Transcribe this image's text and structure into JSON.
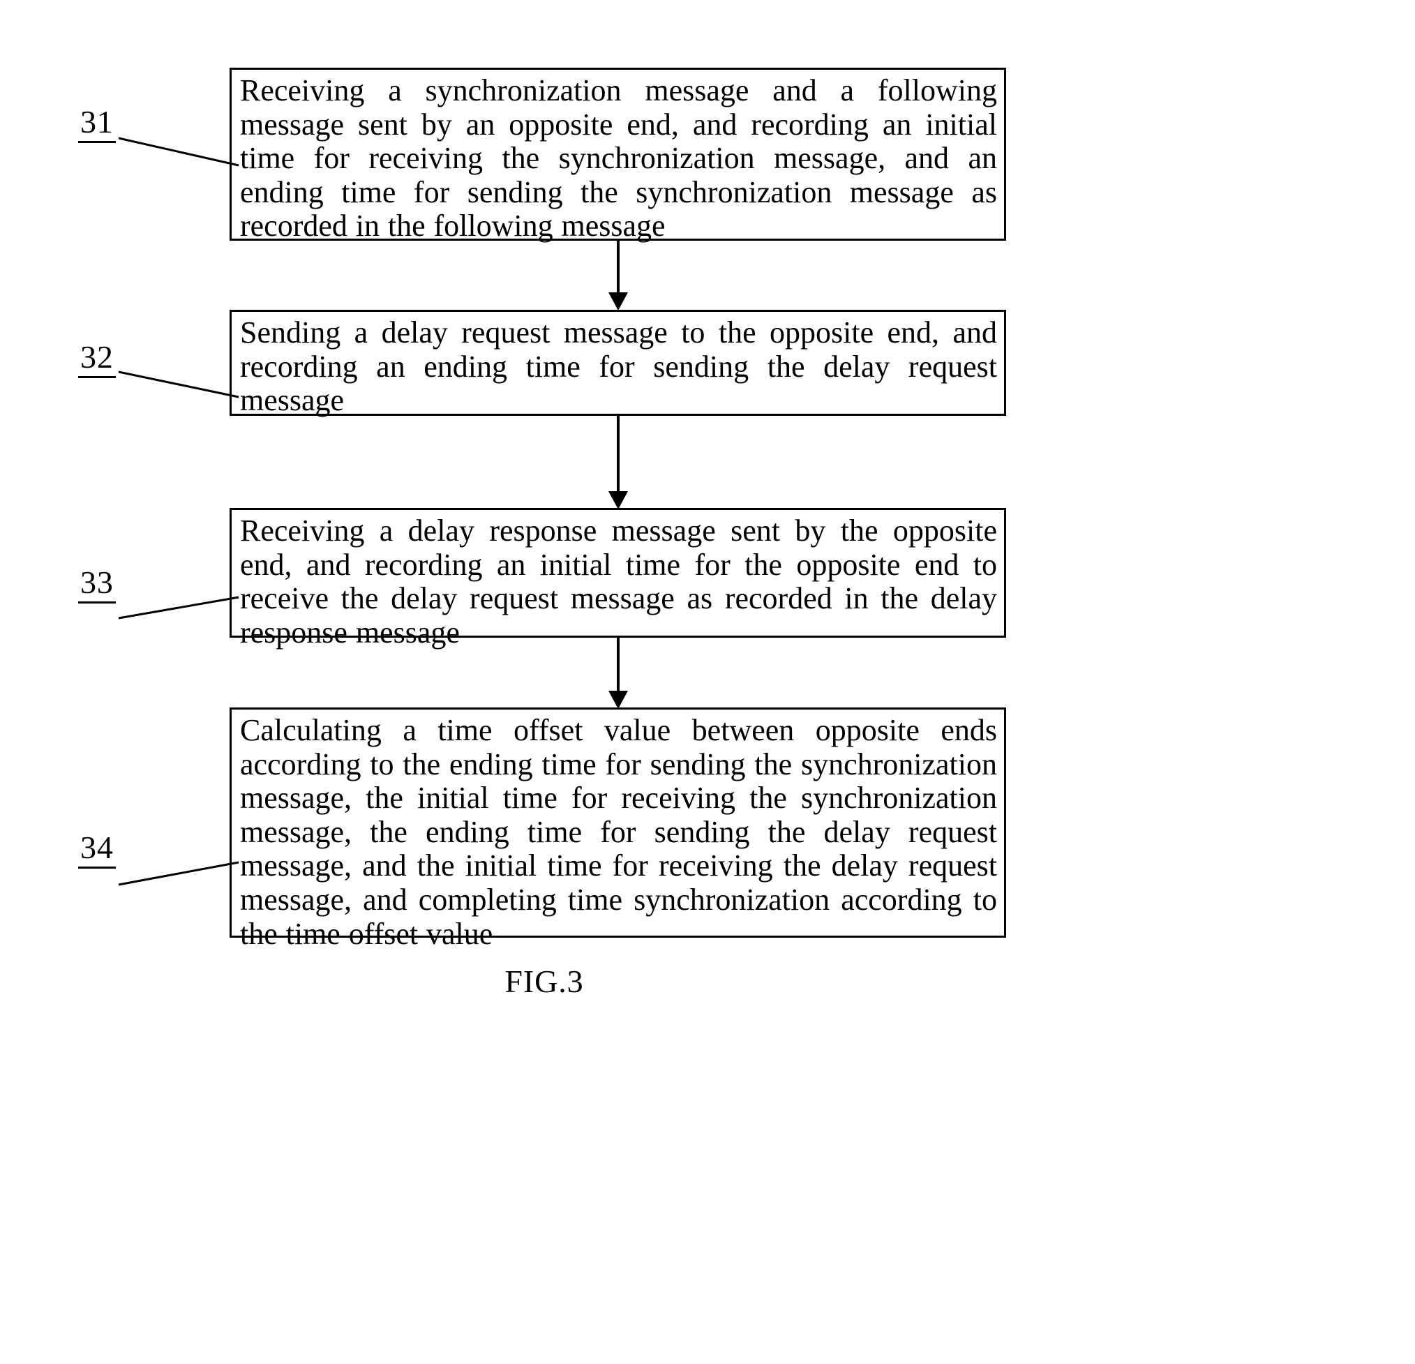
{
  "figure": {
    "caption": "FIG.3",
    "type": "patent-process-flowchart"
  },
  "steps": [
    {
      "number": "31",
      "text": "Receiving a synchronization message and a following message sent by an opposite end, and recording an initial time for receiving the synchronization message, and an ending time for sending the synchronization message as recorded in the following message"
    },
    {
      "number": "32",
      "text": "Sending a delay request message to the opposite end, and recording an ending time for sending the delay request message"
    },
    {
      "number": "33",
      "text": "Receiving a delay response message sent by the opposite end, and recording an initial time for the opposite end to receive the delay request message as recorded in the delay response message"
    },
    {
      "number": "34",
      "text": "Calculating a time offset value between opposite ends according to the ending time for sending the synchronization message, the initial time for receiving the synchronization message, the ending time for sending the delay request message, and the initial time for receiving the delay request message, and completing time synchronization according to the time offset value"
    }
  ],
  "connectors": [
    {
      "from": "31",
      "to": "32"
    },
    {
      "from": "32",
      "to": "33"
    },
    {
      "from": "33",
      "to": "34"
    }
  ],
  "colors": {
    "stroke": "#000000",
    "background": "#ffffff"
  }
}
